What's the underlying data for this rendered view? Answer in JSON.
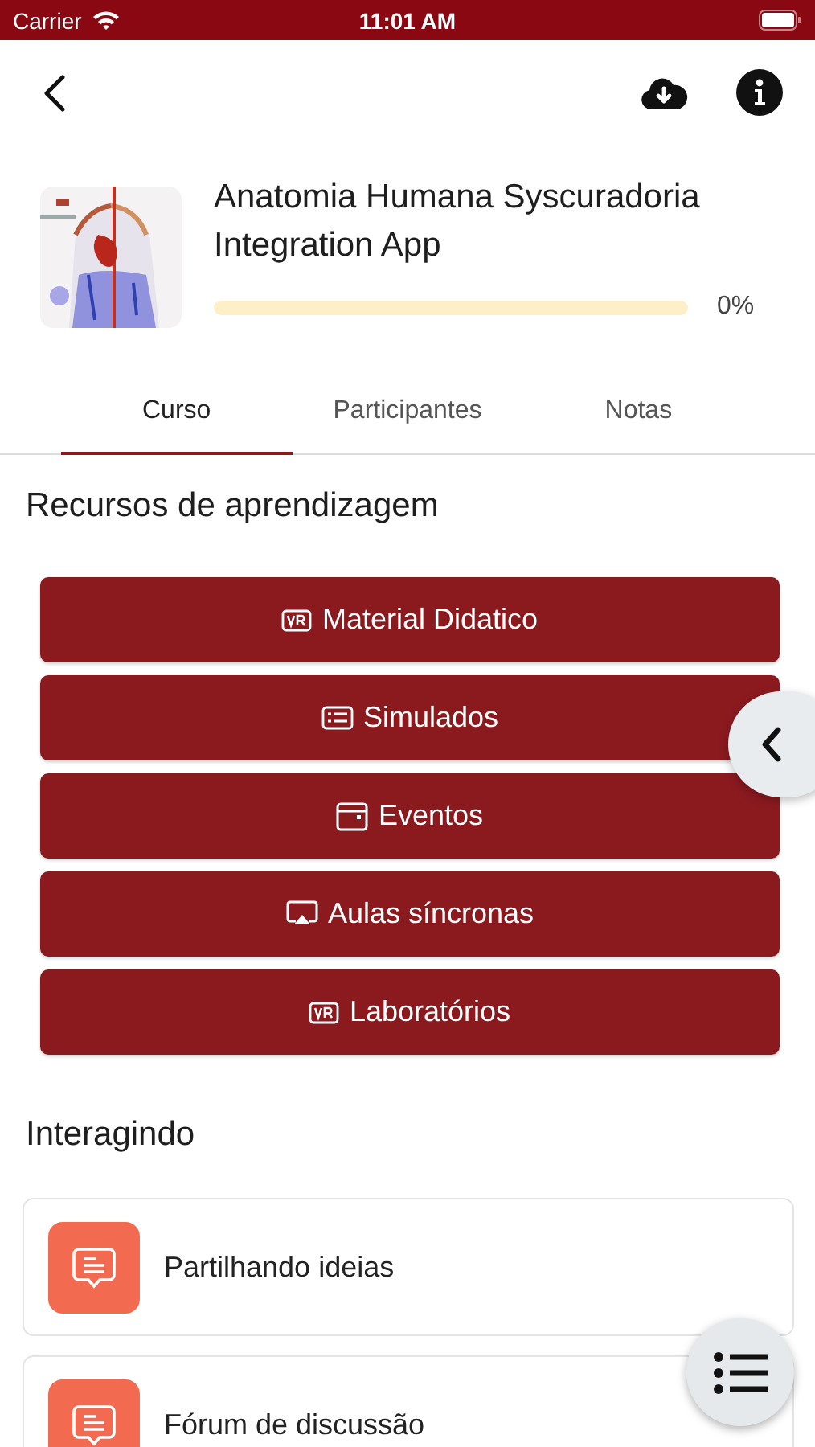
{
  "status_bar": {
    "carrier": "Carrier",
    "time": "11:01 AM"
  },
  "course": {
    "title": "Anatomia Humana Syscuradoria Integration App",
    "progress": {
      "level": 0,
      "reading": "0%"
    }
  },
  "tabs": [
    {
      "label": "Curso",
      "selected": true
    },
    {
      "label": "Participantes",
      "selected": false
    },
    {
      "label": "Notas",
      "selected": false
    }
  ],
  "resources": {
    "heading": "Recursos de aprendizagem",
    "buttons": [
      {
        "label": "Material Didatico",
        "kind": "vr"
      },
      {
        "label": "Simulados",
        "kind": "list"
      },
      {
        "label": "Eventos",
        "kind": "calendar"
      },
      {
        "label": "Aulas síncronas",
        "kind": "screen"
      },
      {
        "label": "Laboratórios",
        "kind": "vr"
      }
    ]
  },
  "interacting": {
    "heading": "Interagindo",
    "items": [
      {
        "label": "Partilhando ideias"
      },
      {
        "label": "Fórum de discussão"
      }
    ]
  }
}
